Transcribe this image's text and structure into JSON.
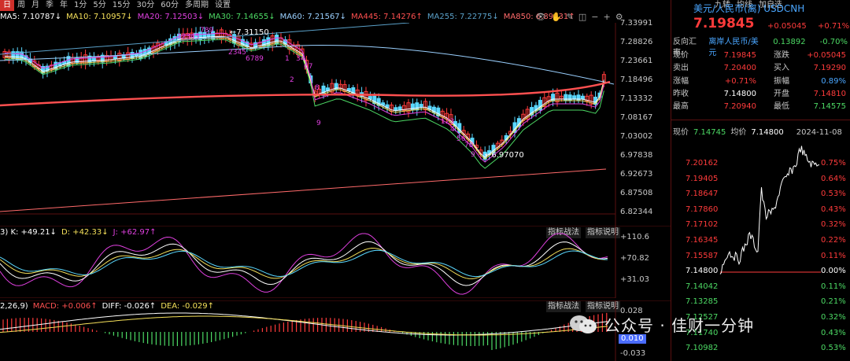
{
  "toolbar": {
    "items": [
      "日",
      "周",
      "月",
      "季",
      "年",
      "1分",
      "5分",
      "15分",
      "30分",
      "60分",
      "多周期",
      "设置"
    ],
    "active_index": 0,
    "right": [
      "九转",
      "均线",
      "加自选"
    ]
  },
  "ma_legend": [
    {
      "text": "MA5: 7.10787↓",
      "color": "#ffffff"
    },
    {
      "text": "MA10: 7.10957↓",
      "color": "#f5e05a"
    },
    {
      "text": "MA20: 7.12503↓",
      "color": "#e040e0"
    },
    {
      "text": "MA30: 7.14655↓",
      "color": "#4cd964"
    },
    {
      "text": "MA60: 7.21567↓",
      "color": "#9ad0ff"
    },
    {
      "text": "MA445: 7.14276↑",
      "color": "#ff5050"
    },
    {
      "text": "MA255: 7.22775↓",
      "color": "#5aa0c8"
    },
    {
      "text": "MA850: 6.89631↑",
      "color": "#ff6a6a"
    }
  ],
  "main_axis": [
    "7.33991",
    "7.28826",
    "7.23661",
    "7.18496",
    "7.13332",
    "7.08167",
    "7.03002",
    "6.97838",
    "6.92673",
    "6.87508",
    "6.82344"
  ],
  "annotations": {
    "high": "7.31150",
    "low": "6.97070"
  },
  "kdj": {
    "legend": [
      {
        "text": "3) K: +49.21↓",
        "color": "#ffffff"
      },
      {
        "text": "D: +42.33↓",
        "color": "#f5e05a"
      },
      {
        "text": "J: +62.97↑",
        "color": "#e040e0"
      }
    ],
    "axis": [
      "+110.6",
      "+70.82",
      "+31.03"
    ],
    "buttons": [
      "指标战法",
      "指标说明"
    ]
  },
  "macd": {
    "legend": [
      {
        "text": "2,26,9)",
        "color": "#ffffff"
      },
      {
        "text": "MACD: +0.006↑",
        "color": "#ff5050"
      },
      {
        "text": "DIFF: -0.026↑",
        "color": "#ffffff"
      },
      {
        "text": "DEA: -0.029↑",
        "color": "#f5e05a"
      }
    ],
    "axis": [
      "0.028",
      "-0.033"
    ],
    "box_value": "0.010",
    "buttons": [
      "指标战法",
      "指标说明"
    ]
  },
  "side": {
    "title": "美元/人民币(离) USDCNH",
    "price": "7.19845",
    "change": "+0.05045",
    "change_pct": "+0.71%",
    "reverse_label": "反向汇率:",
    "reverse_name": "离岸人民币/美元",
    "reverse_value": "0.13892",
    "reverse_pct": "-0.70%",
    "quotes": [
      {
        "l1": "现价",
        "v1": "7.19845",
        "l2": "涨跌",
        "v2": "+0.05045",
        "c1": "#ff3b3b",
        "c2": "#ff3b3b"
      },
      {
        "l1": "卖出",
        "v1": "7.20400",
        "l2": "买入",
        "v2": "7.19290",
        "c1": "#ff3b3b",
        "c2": "#ff3b3b"
      },
      {
        "l1": "涨幅",
        "v1": "+0.71%",
        "l2": "振幅",
        "v2": "0.89%",
        "c1": "#ff3b3b",
        "c2": "#4aa6ff"
      },
      {
        "l1": "昨收",
        "v1": "7.14800",
        "l2": "开盘",
        "v2": "7.14810",
        "c1": "#ffffff",
        "c2": "#ff3b3b"
      },
      {
        "l1": "最高",
        "v1": "7.20940",
        "l2": "最低",
        "v2": "7.14575",
        "c1": "#ff3b3b",
        "c2": "#4cd964"
      }
    ],
    "intraday_header": {
      "now_label": "现价",
      "now_value": "7.14745",
      "avg_label": "均价",
      "avg_value": "7.14800",
      "date": "2024-11-08"
    },
    "left_axis": [
      "7.20162",
      "7.19405",
      "7.18647",
      "7.17860",
      "7.17102",
      "7.16345",
      "7.15587",
      "7.14800",
      "7.14042",
      "7.13285",
      "7.12527",
      "7.11740",
      "7.10982"
    ],
    "right_axis": [
      "0.75%",
      "0.64%",
      "0.53%",
      "0.43%",
      "0.32%",
      "0.22%",
      "0.11%",
      "0.00%",
      "0.11%",
      "0.21%",
      "0.32%",
      "0.43%",
      "0.53%"
    ]
  },
  "watermark": "公众号 · 佳财一分钟"
}
